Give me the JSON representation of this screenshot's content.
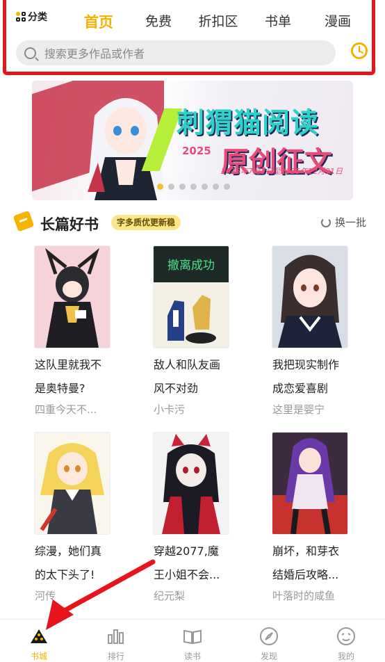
{
  "header": {
    "category_label": "分类",
    "tabs": [
      "首页",
      "免费",
      "折扣区",
      "书单",
      "漫画"
    ],
    "active_tab": 0,
    "search_placeholder": "搜索更多作品或作者"
  },
  "banner": {
    "title": "刺猬猫阅读",
    "year": "2025",
    "subtitle": "原创征文",
    "dates": "2025年7月1日至2025年12月31日",
    "page_count": 7,
    "active_page": 0
  },
  "section": {
    "title": "长篇好书",
    "badge": "字多质优更新稳",
    "refresh_label": "换一批"
  },
  "books": [
    {
      "title_line1": "这队里就我不",
      "title_line2": "是奥特曼?",
      "author": "四重今天不..."
    },
    {
      "title_line1": "敌人和队友画",
      "title_line2": "风不对劲",
      "author": "小卡污",
      "cover_text": "撤离成功"
    },
    {
      "title_line1": "我把现实制作",
      "title_line2": "成恋爱喜剧",
      "author": "这里是婴宁"
    },
    {
      "title_line1": "综漫，她们真",
      "title_line2": "的太下头了!",
      "author": "河传"
    },
    {
      "title_line1": "穿越2077,魔",
      "title_line2": "王小姐不会...",
      "author": "纪元梨"
    },
    {
      "title_line1": "崩坏，和芽衣",
      "title_line2": "结婚后攻略...",
      "author": "叶落时的咸鱼"
    }
  ],
  "tabbar": {
    "items": [
      "书城",
      "排行",
      "读书",
      "发现",
      "我的"
    ],
    "active": 0
  },
  "colors": {
    "accent": "#f2b200",
    "highlight_box": "#e8141c"
  }
}
